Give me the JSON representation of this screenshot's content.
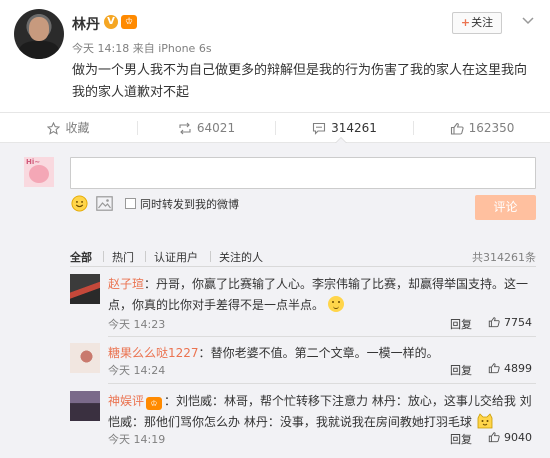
{
  "post": {
    "username": "林丹",
    "verified_mark": "V",
    "vip_mark": "♔",
    "meta": "今天 14:18 来自 iPhone 6s",
    "follow_label": "关注",
    "follow_plus": "+",
    "text": "做为一个男人我不为自己做更多的辩解但是我的行为伤害了我的家人在这里我向我的家人道歉对不起"
  },
  "actions": [
    {
      "label": "收藏",
      "icon": "star-icon"
    },
    {
      "label": "64021",
      "icon": "repost-icon"
    },
    {
      "label": "314261",
      "icon": "comment-icon"
    },
    {
      "label": "162350",
      "icon": "thumbs-up-icon"
    }
  ],
  "composer": {
    "input_value": "",
    "input_placeholder": "",
    "repost_label": "同时转发到我的微博",
    "submit_label": "评论",
    "submit_color": "#ffc09f",
    "avatar_text": "Hi~"
  },
  "filters": {
    "items": [
      "全部",
      "热门",
      "认证用户",
      "关注的人"
    ],
    "total": "共314261条"
  },
  "comments": [
    {
      "name": "赵子瑄",
      "separator": "：",
      "text": "丹哥，你赢了比赛输了人心。李宗伟输了比赛，却赢得举国支持。这一点，你真的比你对手差得不是一点半点。",
      "time": "今天 14:23",
      "reply": "回复",
      "likes": "7754"
    },
    {
      "name": "糖果么么哒1227",
      "separator": "：",
      "text": "替你老婆不值。第二个文章。一模一样的。",
      "time": "今天 14:24",
      "reply": "回复",
      "likes": "4899"
    },
    {
      "name": "神娱评",
      "vip_mark": "♔",
      "separator": "：",
      "text": "刘恺威：林哥，帮个忙转移下注意力 林丹：放心，这事儿交给我 刘恺威：那他们骂你怎么办 林丹：没事，我就说我在房间教她打羽毛球",
      "time": "今天 14:19",
      "reply": "回复",
      "likes": "9040"
    }
  ],
  "colors": {
    "accent": "#eb7350",
    "section_bg": "#f2f2f5",
    "muted_text": "#808080"
  }
}
